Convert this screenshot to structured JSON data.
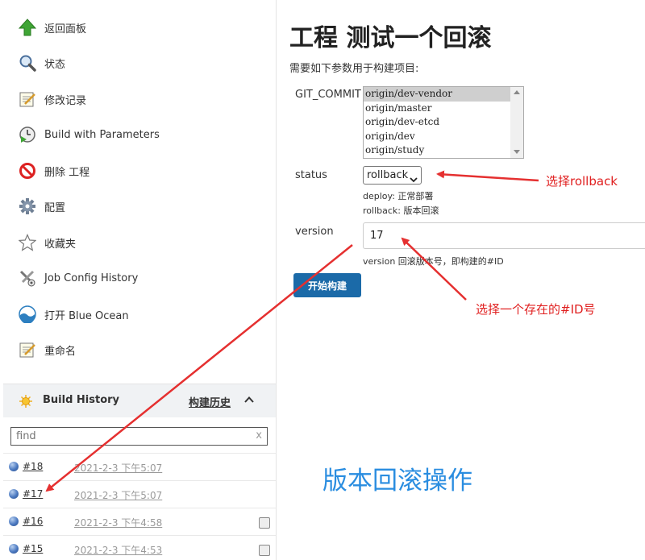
{
  "sidebar": {
    "items": [
      {
        "label": "返回面板",
        "icon": "up-arrow-icon"
      },
      {
        "label": "状态",
        "icon": "magnifier-icon"
      },
      {
        "label": "修改记录",
        "icon": "notepad-icon"
      },
      {
        "label": "Build with Parameters",
        "icon": "clock-build-icon"
      },
      {
        "label": "删除 工程",
        "icon": "no-entry-icon"
      },
      {
        "label": "配置",
        "icon": "gear-icon"
      },
      {
        "label": "收藏夹",
        "icon": "star-icon"
      },
      {
        "label": "Job Config History",
        "icon": "tools-icon"
      },
      {
        "label": "打开 Blue Ocean",
        "icon": "blue-ocean-icon"
      },
      {
        "label": "重命名",
        "icon": "notepad-icon"
      }
    ]
  },
  "build_history": {
    "title": "Build History",
    "trend_link": "构建历史",
    "find_placeholder": "find",
    "clear_label": "x",
    "builds": [
      {
        "number": "#18",
        "date": "2021-2-3 下午5:07",
        "console": false
      },
      {
        "number": "#17",
        "date": "2021-2-3 下午5:07",
        "console": false
      },
      {
        "number": "#16",
        "date": "2021-2-3 下午4:58",
        "console": true
      },
      {
        "number": "#15",
        "date": "2021-2-3 下午4:53",
        "console": true
      }
    ]
  },
  "main": {
    "title": "工程 测试一个回滚",
    "description": "需要如下参数用于构建项目:",
    "params": {
      "commit": {
        "label": "GIT_COMMIT",
        "options": [
          "origin/dev-vendor",
          "origin/master",
          "origin/dev-etcd",
          "origin/dev",
          "origin/study"
        ],
        "selected": "origin/dev-vendor"
      },
      "status": {
        "label": "status",
        "value": "rollback",
        "help_line1": "deploy: 正常部署",
        "help_line2": "rollback: 版本回滚"
      },
      "version": {
        "label": "version",
        "value": "17",
        "help": "version 回滚版本号，即构建的#ID"
      }
    },
    "build_button": "开始构建"
  },
  "annotations": {
    "choose_rollback": "选择rollback",
    "choose_id": "选择一个存在的#ID号",
    "rollback_operation": "版本回滚操作"
  },
  "colors": {
    "annotation_red": "#e02020",
    "annotation_blue": "#2a8de0",
    "button_blue": "#1b6aa8",
    "build_ball_blue": "#4a78c0"
  }
}
